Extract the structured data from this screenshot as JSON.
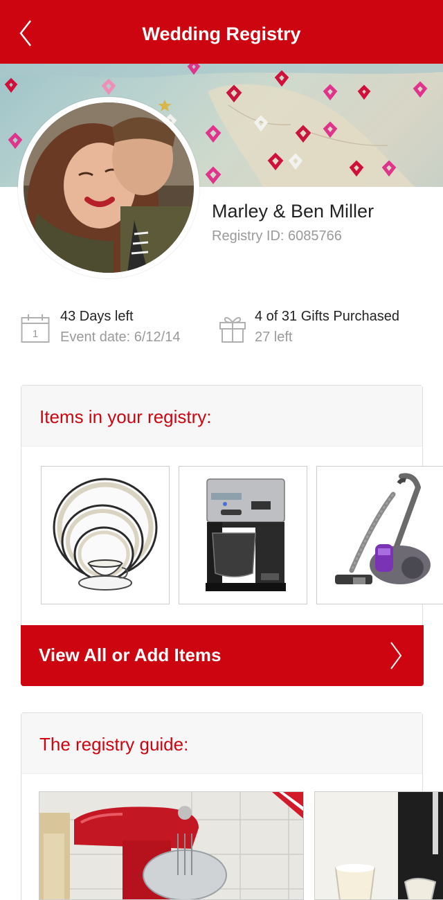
{
  "header": {
    "title": "Wedding Registry",
    "back_icon": "chevron-left-icon"
  },
  "profile": {
    "name": "Marley & Ben Miller",
    "registry_id": "Registry ID: 6085766"
  },
  "stats": {
    "days": {
      "icon": "calendar-icon",
      "calendar_day": "1",
      "title": "43 Days left",
      "subtitle": "Event date: 6/12/14"
    },
    "gifts": {
      "icon": "gift-icon",
      "title": "4 of 31 Gifts Purchased",
      "subtitle": "27 left"
    }
  },
  "items_section": {
    "title": "Items in your registry:",
    "items": [
      {
        "image": "dinnerware-set"
      },
      {
        "image": "coffee-maker"
      },
      {
        "image": "vacuum-cleaner"
      }
    ],
    "cta_label": "View All or Add Items",
    "cta_icon": "chevron-right-icon"
  },
  "guide_section": {
    "title": "The registry guide:",
    "images": [
      {
        "image": "red-stand-mixer"
      },
      {
        "image": "glassware"
      }
    ]
  },
  "colors": {
    "brand_red": "#cc0510",
    "muted_text": "#9a9a9a",
    "panel_bg": "#f7f7f7"
  }
}
